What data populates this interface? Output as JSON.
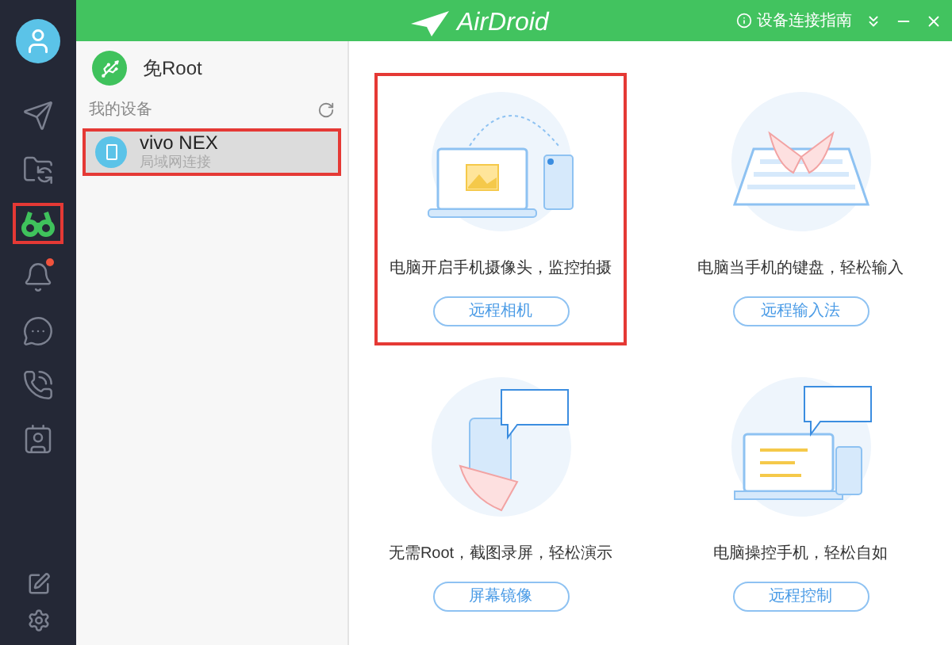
{
  "header": {
    "logo": "AirDroid",
    "guide": "设备连接指南"
  },
  "nav": [
    {
      "kind": "send",
      "selected": false,
      "badge": false,
      "highlighted": false
    },
    {
      "kind": "folder",
      "selected": false,
      "badge": false,
      "highlighted": false
    },
    {
      "kind": "binoculars",
      "selected": true,
      "badge": false,
      "highlighted": true
    },
    {
      "kind": "bell",
      "selected": false,
      "badge": true,
      "highlighted": false
    },
    {
      "kind": "chat",
      "selected": false,
      "badge": false,
      "highlighted": false
    },
    {
      "kind": "phone",
      "selected": false,
      "badge": false,
      "highlighted": false
    },
    {
      "kind": "contacts",
      "selected": false,
      "badge": false,
      "highlighted": false
    }
  ],
  "panel": {
    "no_root": "免Root",
    "section": "我的设备",
    "devices": [
      {
        "name": "vivo NEX",
        "status": "局域网连接",
        "selected": true,
        "highlighted": true
      }
    ]
  },
  "features": [
    {
      "kind": "camera",
      "text": "电脑开启手机摄像头，监控拍摄",
      "button": "远程相机",
      "highlighted": true
    },
    {
      "kind": "keyboard",
      "text": "电脑当手机的键盘，轻松输入",
      "button": "远程输入法",
      "highlighted": false
    },
    {
      "kind": "mirror",
      "text": "无需Root，截图录屏，轻松演示",
      "button": "屏幕镜像",
      "highlighted": false
    },
    {
      "kind": "control",
      "text": "电脑操控手机，轻松自如",
      "button": "远程控制",
      "highlighted": false
    }
  ]
}
